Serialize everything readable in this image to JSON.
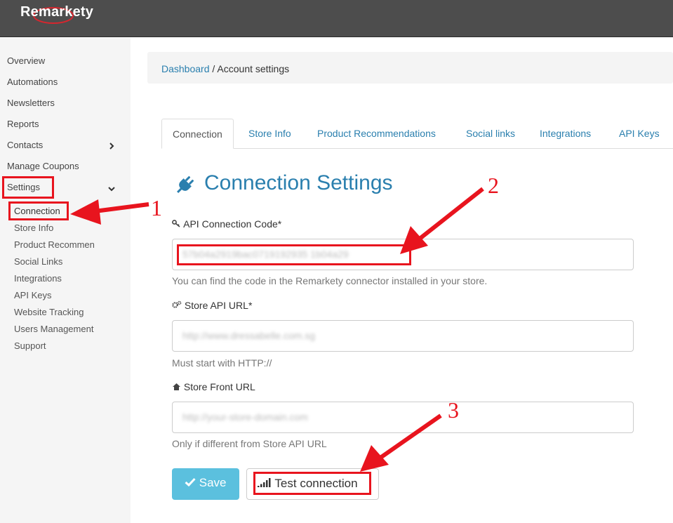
{
  "app": {
    "logo_text": "Remarkety"
  },
  "sidebar": {
    "items": [
      {
        "label": "Overview"
      },
      {
        "label": "Automations"
      },
      {
        "label": "Newsletters"
      },
      {
        "label": "Reports"
      },
      {
        "label": "Contacts"
      },
      {
        "label": "Manage Coupons"
      },
      {
        "label": "Settings"
      }
    ],
    "settings_subitems": [
      {
        "label": "Connection"
      },
      {
        "label": "Store Info"
      },
      {
        "label": "Product Recommendations"
      },
      {
        "label": "Social Links"
      },
      {
        "label": "Integrations"
      },
      {
        "label": "API Keys"
      },
      {
        "label": "Website Tracking"
      },
      {
        "label": "Users Management"
      },
      {
        "label": "Support"
      }
    ]
  },
  "breadcrumb": {
    "link": "Dashboard",
    "separator": " / ",
    "current": "Account settings"
  },
  "tabs": [
    {
      "label": "Connection",
      "active": true
    },
    {
      "label": "Store Info"
    },
    {
      "label": "Product Recommendations"
    },
    {
      "label": "Social links"
    },
    {
      "label": "Integrations"
    },
    {
      "label": "API Keys"
    }
  ],
  "page": {
    "title": "Connection Settings"
  },
  "form": {
    "api_code": {
      "label": "API Connection Code",
      "required_mark": "*",
      "value": "57b04a2919bac0719192935 1b04a29",
      "help": "You can find the code in the Remarkety connector installed in your store."
    },
    "store_api_url": {
      "label": "Store API URL",
      "required_mark": "*",
      "value": "http://www.dressabelle.com.sg",
      "help": "Must start with HTTP://"
    },
    "store_front_url": {
      "label": "Store Front URL",
      "placeholder": "http://your-store-domain.com",
      "help": "Only if different from Store API URL"
    },
    "save_label": "Save",
    "test_label": "Test connection"
  },
  "annotations": {
    "step1": "1",
    "step2": "2",
    "step3": "3",
    "color": "#e8141e"
  },
  "colors": {
    "topbar": "#4d4d4d",
    "accent": "#2a7fae",
    "save_button": "#5bc0de",
    "sidebar": "#f5f5f5"
  },
  "icons": {
    "plug": "plug-icon",
    "key": "key-icon",
    "gears": "gears-icon",
    "home": "home-icon",
    "check": "check-icon",
    "signal": "signal-icon"
  }
}
